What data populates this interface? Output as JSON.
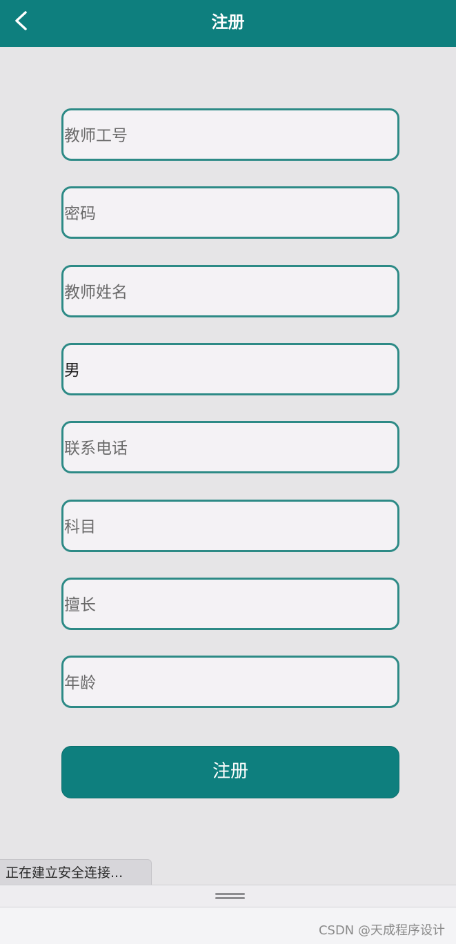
{
  "header": {
    "title": "注册",
    "back_icon": "chevron-left-icon"
  },
  "form": {
    "teacher_id_placeholder": "教师工号",
    "password_placeholder": "密码",
    "teacher_name_placeholder": "教师姓名",
    "gender_value": "男",
    "phone_placeholder": "联系电话",
    "subject_placeholder": "科目",
    "specialty_placeholder": "擅长",
    "age_placeholder": "年龄",
    "submit_label": "注册"
  },
  "status": {
    "text": "正在建立安全连接..."
  },
  "footer": {
    "watermark": "CSDN @天成程序设计"
  },
  "colors": {
    "accent": "#0e7f7e",
    "field_border": "#2d8a86",
    "background": "#e6e5e7"
  }
}
